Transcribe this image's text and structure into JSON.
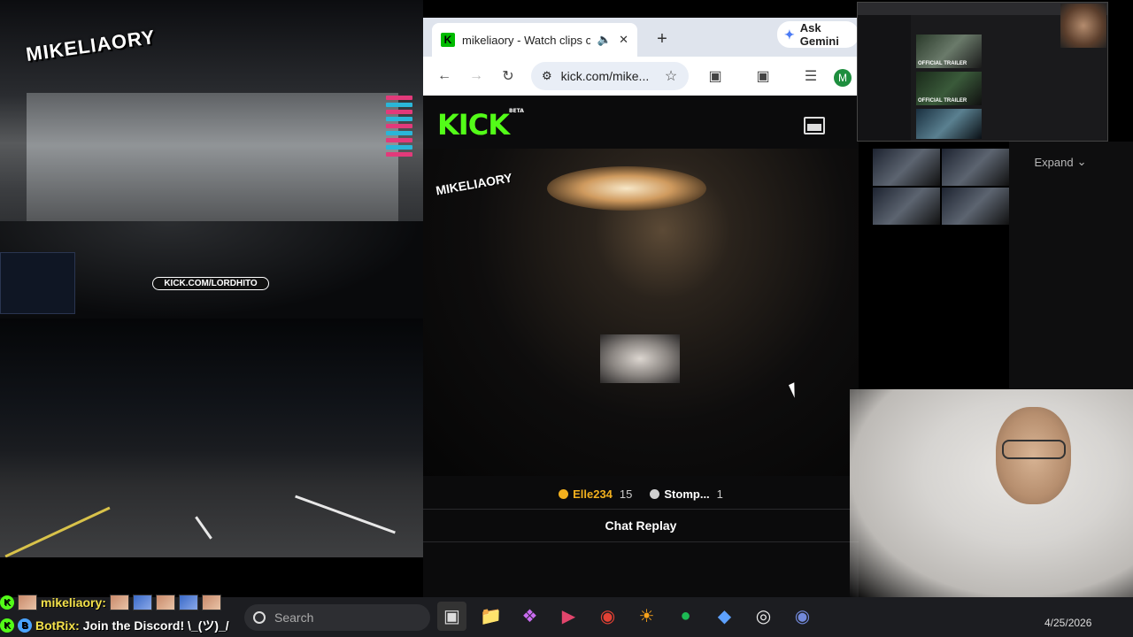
{
  "overlay": {
    "brand_logo": "MIKELIAORY",
    "kick_banner": "KICK.COM/LORDHITO"
  },
  "browser": {
    "tab": {
      "favicon": "K",
      "title": "mikeliaory - Watch clips on",
      "mute_icon": "speaker-icon",
      "close_icon": "close-icon"
    },
    "new_tab_label": "+",
    "address": "kick.com/mike...",
    "profile_initial": "M",
    "gemini_label": "Ask Gemini",
    "page": {
      "logo": "KICK",
      "logo_badge": "BETA",
      "video_logo": "MIKELIAORY",
      "gifters": [
        {
          "name": "Elle234",
          "count": "15",
          "color": "#f2b01e"
        },
        {
          "name": "Stomp...",
          "count": "1",
          "color": "#d0d0d0"
        }
      ],
      "chat_replay_label": "Chat Replay"
    }
  },
  "right_panel": {
    "expand_label": "Expand",
    "trailers": [
      "OFFICIAL TRAILER",
      "OFFICIAL TRAILER"
    ]
  },
  "chat_overlay": {
    "line1_user": "mikeliaory:",
    "line2_user": "BotRix:",
    "line2_text": "Join the Discord! \\_(ツ)_/"
  },
  "taskbar": {
    "search_placeholder": "Search",
    "apps": [
      "file-explorer-icon",
      "folder-icon",
      "copilot-icon",
      "pdf-icon",
      "chrome-icon",
      "sun-icon",
      "spotify-icon",
      "vscode-icon",
      "obs-icon",
      "discord-icon"
    ],
    "date": "4/25/2026"
  },
  "colors": {
    "kick_green": "#53fc18",
    "page_bg": "#0b0b0c",
    "taskbar_bg": "#1c1d21"
  }
}
